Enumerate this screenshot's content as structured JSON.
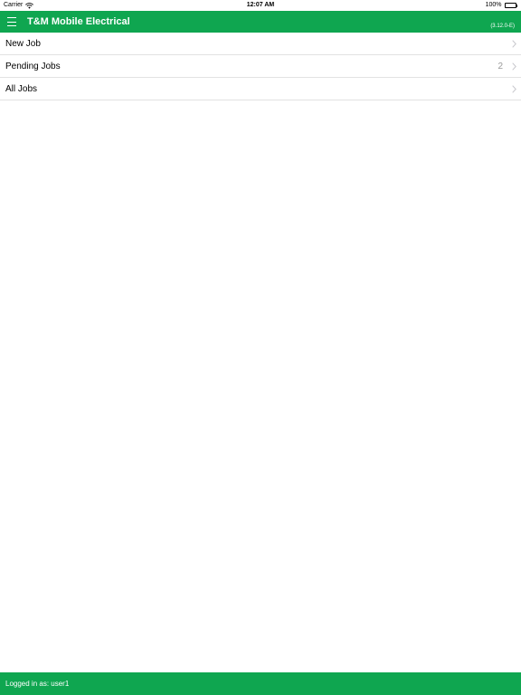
{
  "status_bar": {
    "carrier": "Carrier",
    "time": "12:07 AM",
    "battery": "100%"
  },
  "nav": {
    "title": "T&M Mobile Electrical",
    "version": "(3.12.0-E)",
    "menu_icon": "hamburger-menu-icon"
  },
  "jobs": {
    "items": [
      {
        "label": "New Job",
        "count": ""
      },
      {
        "label": "Pending Jobs",
        "count": "2"
      },
      {
        "label": "All Jobs",
        "count": ""
      }
    ]
  },
  "footer": {
    "logged_in_text": "Logged in as: user1"
  },
  "colors": {
    "brand_green": "#0fa650",
    "separator": "#e2e2e2",
    "count_text": "#999999"
  }
}
